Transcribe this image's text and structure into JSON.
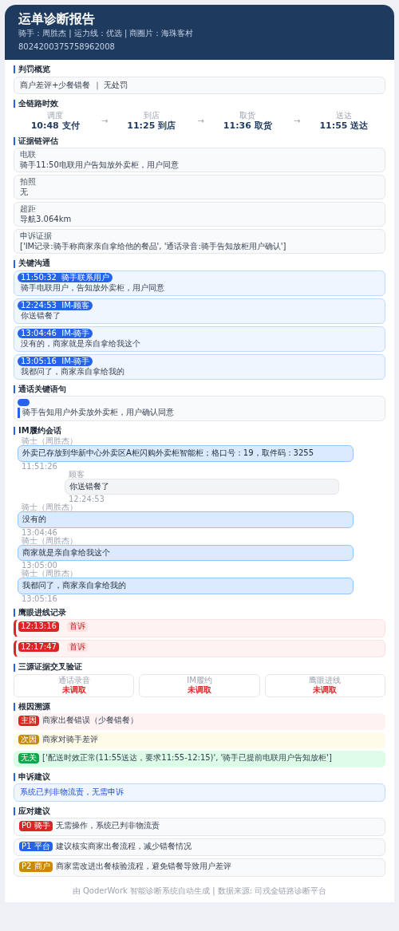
{
  "header": {
    "title": "运单诊断报告",
    "meta": "骑手：周胜杰 | 运力线：优选 | 商圈片：海珠客村",
    "order_id": "8024200375758962008"
  },
  "verdict": {
    "title": "判罚概览",
    "text": "商户差评+少餐错餐 ｜ 无处罚"
  },
  "timeline": {
    "title": "全链路时效",
    "arrow": "→",
    "steps": [
      {
        "label": "调度",
        "value": "10:48 支付"
      },
      {
        "label": "到店",
        "value": "11:25 到店"
      },
      {
        "label": "取货",
        "value": "11:36 取货"
      },
      {
        "label": "送达",
        "value": "11:55 送达"
      }
    ]
  },
  "evidence": {
    "title": "证据链评估",
    "items": [
      {
        "label": "电联",
        "text": "骑手11:50电联用户告知放外卖柜，用户同意"
      },
      {
        "label": "拍照",
        "text": "无"
      },
      {
        "label": "超距",
        "text": "导航3.064km"
      },
      {
        "label": "申诉证据",
        "text": "['IM记录:骑手称商家亲自拿给他的餐品', '通话录音:骑手告知放柜用户确认']"
      }
    ]
  },
  "key_comms": {
    "title": "关键沟通",
    "items": [
      {
        "tag": "11:50:32  骑手联系用户",
        "text": "骑手电联用户，告知放外卖柜，用户同意"
      },
      {
        "tag": "12:24:53  IM-顾客",
        "text": "你送错餐了"
      },
      {
        "tag": "13:04:46  IM-骑手",
        "text": "没有的，商家就是亲自拿给我这个"
      },
      {
        "tag": "13:05:16  IM-骑手",
        "text": "我都问了，商家亲自拿给我的"
      }
    ]
  },
  "call_keywords": {
    "title": "通话关键语句",
    "text": "骑手告知用户外卖放外卖柜，用户确认同意"
  },
  "im_chat": {
    "title": "IM履约会话",
    "messages": [
      {
        "kind": "rider",
        "sender": "骑士（周胜杰）",
        "text": "外卖已存放到华新中心外卖区A柜闪购外卖柜智能柜；格口号：19，取件码：3255",
        "time": "11:51:26"
      },
      {
        "kind": "customer",
        "sender": "顾客",
        "text": "你送错餐了",
        "time": "12:24:53"
      },
      {
        "kind": "rider",
        "sender": "骑士（周胜杰）",
        "text": "没有的",
        "time": "13:04:46"
      },
      {
        "kind": "rider",
        "sender": "骑士（周胜杰）",
        "text": "商家就是亲自拿给我这个",
        "time": "13:05:00"
      },
      {
        "kind": "rider",
        "sender": "骑士（周胜杰）",
        "text": "我都问了，商家亲自拿给我的",
        "time": "13:05:16"
      }
    ]
  },
  "hawkeye": {
    "title": "鹰眼进线记录",
    "records": [
      {
        "time": "12:13:16",
        "tag": "首诉"
      },
      {
        "time": "12:17:47",
        "tag": "首诉"
      }
    ]
  },
  "cross_check": {
    "title": "三源证据交叉验证",
    "sources": [
      {
        "label": "通话录音",
        "value": "未调取",
        "ok": false
      },
      {
        "label": "IM履约",
        "value": "未调取",
        "ok": false
      },
      {
        "label": "鹰眼进线",
        "value": "未调取",
        "ok": false
      }
    ]
  },
  "root_cause": {
    "title": "根因溯源",
    "items": [
      {
        "kind": "main",
        "tag": "主因",
        "text": "商家出餐错误（少餐错餐）"
      },
      {
        "kind": "secondary",
        "tag": "次因",
        "text": "商家对骑手差评"
      },
      {
        "kind": "unrelated",
        "tag": "无关",
        "text": "['配送时效正常(11:55送达，要求11:55-12:15)', '骑手已提前电联用户告知放柜']"
      }
    ]
  },
  "appeal": {
    "title": "申诉建议",
    "text": "系统已判非物流责，无需申诉"
  },
  "actions": {
    "title": "应对建议",
    "items": [
      {
        "kind": "p0",
        "tag": "P0 骑手",
        "text": "无需操作，系统已判非物流责"
      },
      {
        "kind": "p1",
        "tag": "P1 平台",
        "text": "建议核实商家出餐流程，减少错餐情况"
      },
      {
        "kind": "p2",
        "tag": "P2 商户",
        "text": "商家需改进出餐核验流程，避免错餐导致用户差评"
      }
    ]
  },
  "footer": "由 QoderWork 智能诊断系统自动生成 | 数据来源: 司戎全链路诊断平台"
}
